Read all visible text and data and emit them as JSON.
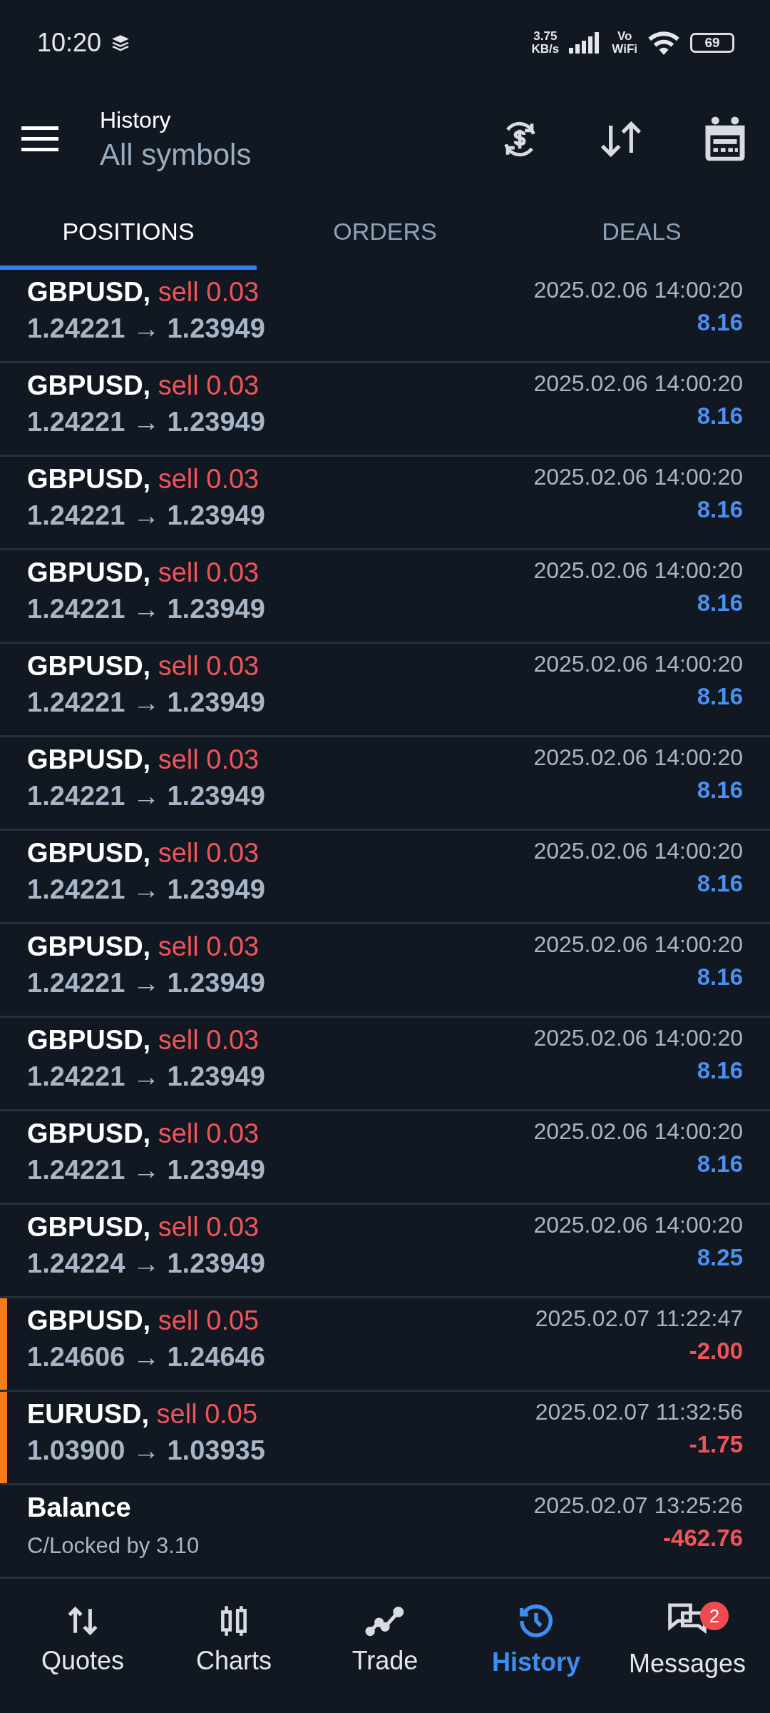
{
  "status_bar": {
    "time": "10:20",
    "speed": "3.75",
    "speed_unit": "KB/s",
    "vo": "Vo",
    "wifi": "WiFi",
    "battery": "69"
  },
  "header": {
    "title": "History",
    "subtitle": "All symbols"
  },
  "tabs": [
    {
      "label": "POSITIONS",
      "selected": true
    },
    {
      "label": "ORDERS",
      "selected": false
    },
    {
      "label": "DEALS",
      "selected": false
    }
  ],
  "rows": [
    {
      "kind": "position",
      "symbol": "GBPUSD,",
      "side": "sell 0.03",
      "prices": "1.24221 → 1.23949",
      "time": "2025.02.06 14:00:20",
      "profit": "8.16",
      "loss": false,
      "marked": false
    },
    {
      "kind": "position",
      "symbol": "GBPUSD,",
      "side": "sell 0.03",
      "prices": "1.24221 → 1.23949",
      "time": "2025.02.06 14:00:20",
      "profit": "8.16",
      "loss": false,
      "marked": false
    },
    {
      "kind": "position",
      "symbol": "GBPUSD,",
      "side": "sell 0.03",
      "prices": "1.24221 → 1.23949",
      "time": "2025.02.06 14:00:20",
      "profit": "8.16",
      "loss": false,
      "marked": false
    },
    {
      "kind": "position",
      "symbol": "GBPUSD,",
      "side": "sell 0.03",
      "prices": "1.24221 → 1.23949",
      "time": "2025.02.06 14:00:20",
      "profit": "8.16",
      "loss": false,
      "marked": false
    },
    {
      "kind": "position",
      "symbol": "GBPUSD,",
      "side": "sell 0.03",
      "prices": "1.24221 → 1.23949",
      "time": "2025.02.06 14:00:20",
      "profit": "8.16",
      "loss": false,
      "marked": false
    },
    {
      "kind": "position",
      "symbol": "GBPUSD,",
      "side": "sell 0.03",
      "prices": "1.24221 → 1.23949",
      "time": "2025.02.06 14:00:20",
      "profit": "8.16",
      "loss": false,
      "marked": false
    },
    {
      "kind": "position",
      "symbol": "GBPUSD,",
      "side": "sell 0.03",
      "prices": "1.24221 → 1.23949",
      "time": "2025.02.06 14:00:20",
      "profit": "8.16",
      "loss": false,
      "marked": false
    },
    {
      "kind": "position",
      "symbol": "GBPUSD,",
      "side": "sell 0.03",
      "prices": "1.24221 → 1.23949",
      "time": "2025.02.06 14:00:20",
      "profit": "8.16",
      "loss": false,
      "marked": false
    },
    {
      "kind": "position",
      "symbol": "GBPUSD,",
      "side": "sell 0.03",
      "prices": "1.24221 → 1.23949",
      "time": "2025.02.06 14:00:20",
      "profit": "8.16",
      "loss": false,
      "marked": false
    },
    {
      "kind": "position",
      "symbol": "GBPUSD,",
      "side": "sell 0.03",
      "prices": "1.24221 → 1.23949",
      "time": "2025.02.06 14:00:20",
      "profit": "8.16",
      "loss": false,
      "marked": false
    },
    {
      "kind": "position",
      "symbol": "GBPUSD,",
      "side": "sell 0.03",
      "prices": "1.24224 → 1.23949",
      "time": "2025.02.06 14:00:20",
      "profit": "8.25",
      "loss": false,
      "marked": false
    },
    {
      "kind": "position",
      "symbol": "GBPUSD,",
      "side": "sell 0.05",
      "prices": "1.24606 → 1.24646",
      "time": "2025.02.07 11:22:47",
      "profit": "-2.00",
      "loss": true,
      "marked": true
    },
    {
      "kind": "position",
      "symbol": "EURUSD,",
      "side": "sell 0.05",
      "prices": "1.03900 → 1.03935",
      "time": "2025.02.07 11:32:56",
      "profit": "-1.75",
      "loss": true,
      "marked": true
    },
    {
      "kind": "balance",
      "symbol": "Balance",
      "comment": "C/Locked by 3.10",
      "time": "2025.02.07 13:25:26",
      "profit": "-462.76",
      "loss": true,
      "marked": false
    }
  ],
  "nav": [
    {
      "kind": "quotes",
      "label": "Quotes",
      "selected": false
    },
    {
      "kind": "charts",
      "label": "Charts",
      "selected": false
    },
    {
      "kind": "trade",
      "label": "Trade",
      "selected": false
    },
    {
      "kind": "history",
      "label": "History",
      "selected": true
    },
    {
      "kind": "messages",
      "label": "Messages",
      "selected": false,
      "badge": "2"
    }
  ]
}
